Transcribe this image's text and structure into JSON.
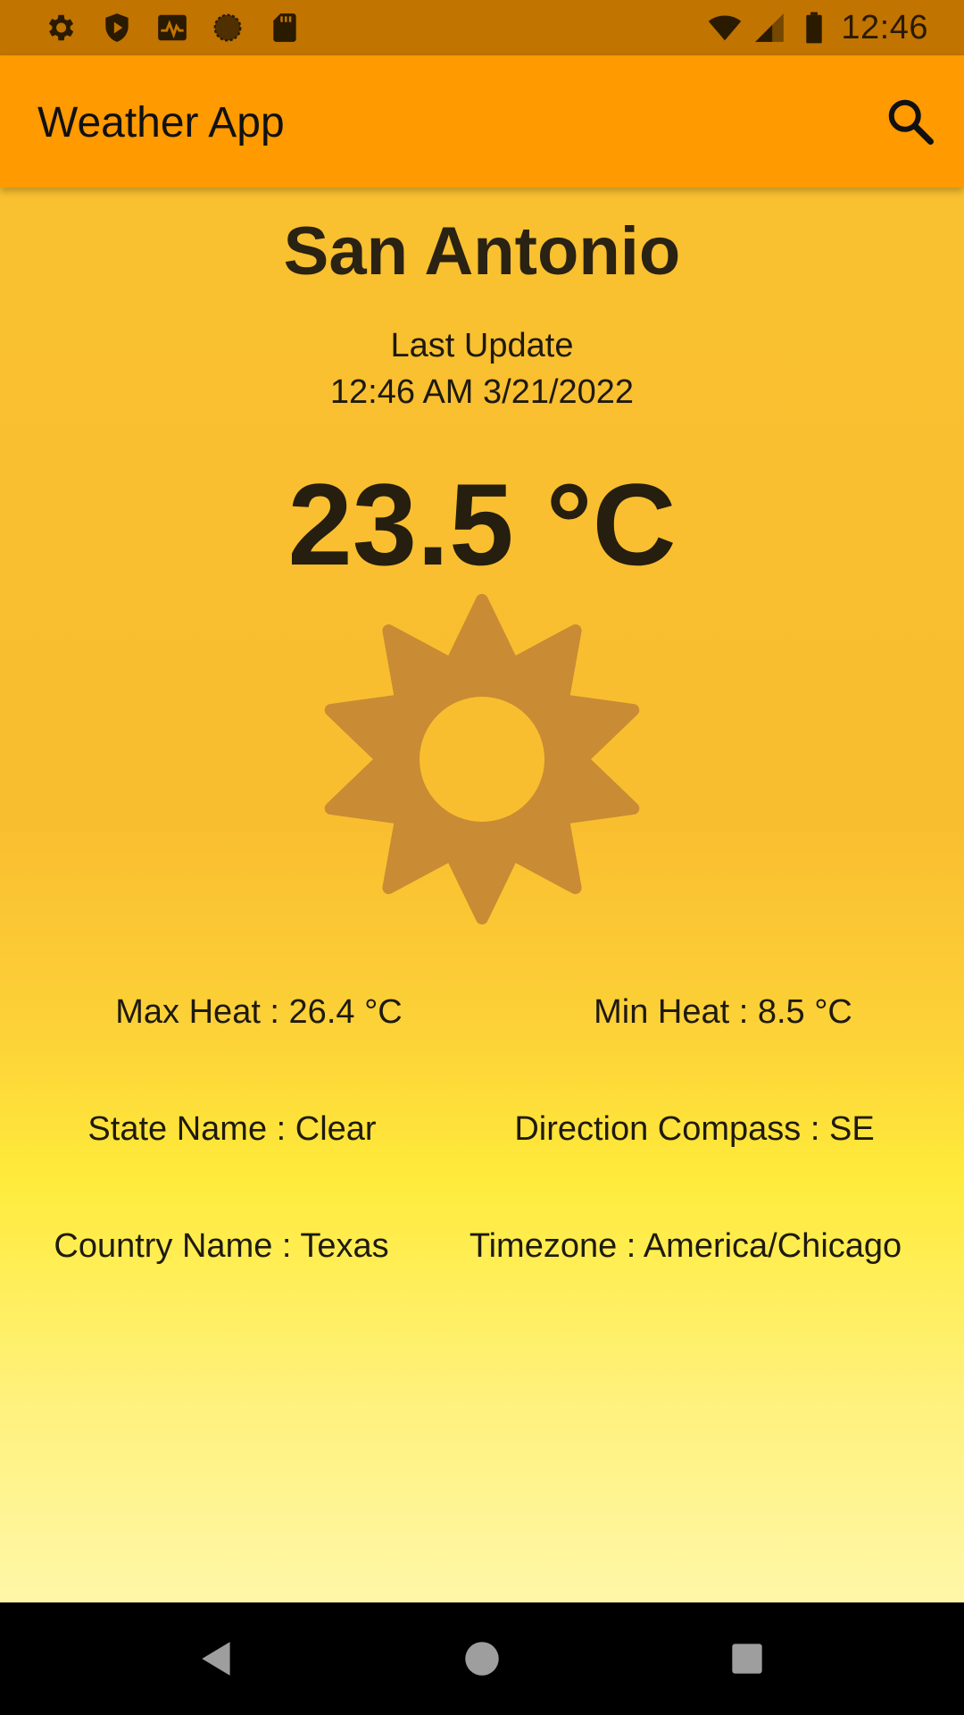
{
  "status_bar": {
    "time": "12:46",
    "left_icons": [
      "settings-icon",
      "shield-play-icon",
      "activity-icon",
      "circle-sync-icon",
      "sd-card-icon"
    ],
    "right_icons": [
      "wifi-icon",
      "signal-icon",
      "battery-icon"
    ]
  },
  "app_bar": {
    "title": "Weather App",
    "search_icon": "search-icon"
  },
  "weather": {
    "city": "San Antonio",
    "last_update_label": "Last Update",
    "last_update_value": "12:46 AM 3/21/2022",
    "temperature": "23.5 °C",
    "condition_icon": "sun-icon",
    "colors": {
      "sun": "#c98b33",
      "app_bar": "#ff9a00",
      "status_bar": "#c17400"
    }
  },
  "details": {
    "max_heat": "Max Heat : 26.4 °C",
    "min_heat": "Min Heat : 8.5 °C",
    "state_name": "State Name : Clear",
    "direction_compass": "Direction Compass : SE",
    "country_name": "Country Name : Texas",
    "timezone": "Timezone : America/Chicago"
  },
  "nav_bar": {
    "buttons": [
      "back-icon",
      "home-icon",
      "recents-icon"
    ]
  }
}
